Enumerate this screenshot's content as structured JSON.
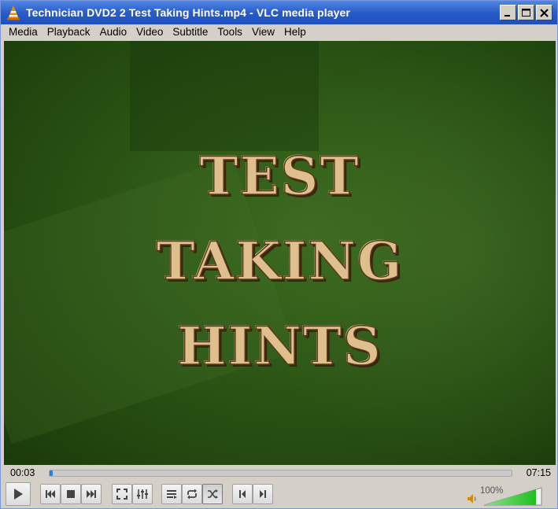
{
  "window": {
    "title": "Technician DVD2 2 Test Taking Hints.mp4 - VLC media player"
  },
  "menu": [
    {
      "label": "Media"
    },
    {
      "label": "Playback"
    },
    {
      "label": "Audio"
    },
    {
      "label": "Video"
    },
    {
      "label": "Subtitle"
    },
    {
      "label": "Tools"
    },
    {
      "label": "View"
    },
    {
      "label": "Help"
    }
  ],
  "video": {
    "overlay_lines": [
      "TEST",
      "TAKING",
      "HINTS"
    ]
  },
  "playback": {
    "elapsed": "00:03",
    "total": "07:15",
    "progress_fraction": 0.007
  },
  "controls": {
    "icons": [
      "play-icon",
      "previous-icon",
      "stop-icon",
      "next-icon",
      "fullscreen-icon",
      "extended-settings-icon",
      "playlist-icon",
      "loop-icon",
      "shuffle-icon",
      "frame-previous-icon",
      "frame-next-icon"
    ],
    "shuffle_active": true
  },
  "volume": {
    "label": "100%",
    "level_fraction": 1.0,
    "accent": "#33cc33"
  },
  "colors": {
    "titlebar": "#2a5cc9",
    "seek_fill": "#2f7fd8",
    "video_tint": "#2c5615"
  }
}
